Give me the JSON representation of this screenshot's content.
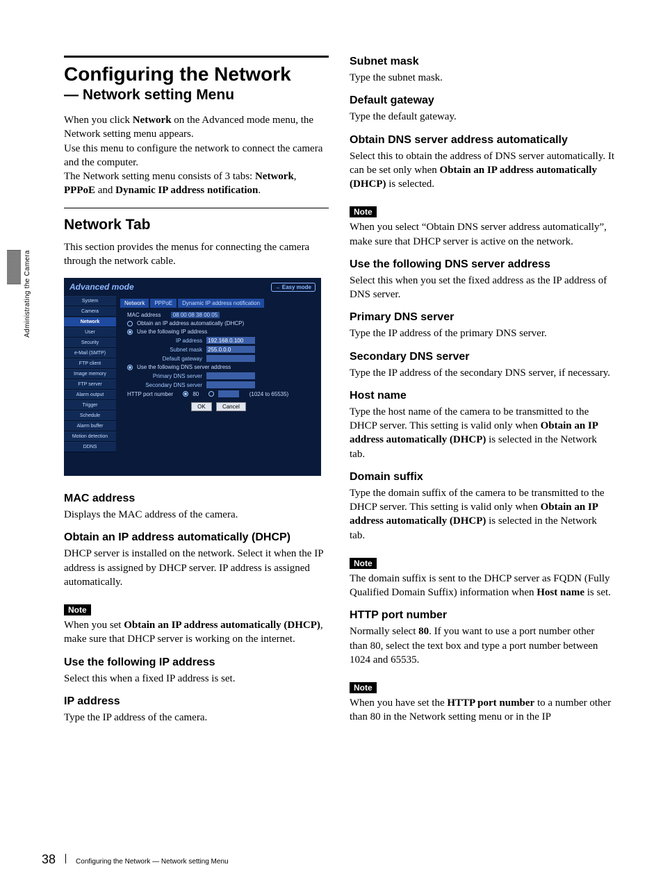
{
  "side_label": "Administrating the Camera",
  "page_number": "38",
  "footer_text": "Configuring the Network — Network setting Menu",
  "left": {
    "main_title": "Configuring the Network",
    "sub_title": "— Network setting Menu",
    "intro_1_pre": "When you click ",
    "intro_1_b1": "Network",
    "intro_1_post": " on the Advanced mode menu, the Network setting menu appears.",
    "intro_2": "Use this menu to configure the network to connect the camera and the computer.",
    "intro_3_pre": "The Network setting menu consists of 3 tabs: ",
    "intro_3_b1": "Network",
    "intro_3_mid": ", ",
    "intro_3_b2": "PPPoE",
    "intro_3_mid2": " and ",
    "intro_3_b3": "Dynamic IP address notification",
    "intro_3_end": ".",
    "h2_network_tab": "Network Tab",
    "nt_text": "This section provides the menus for connecting the camera through the network cable.",
    "mac_h": "MAC address",
    "mac_t": "Displays the MAC address of the camera.",
    "dhcp_h": "Obtain an IP address automatically (DHCP)",
    "dhcp_t": "DHCP server is installed on the network. Select it when the IP address is assigned by DHCP server. IP address is assigned automatically.",
    "note_label": "Note",
    "dhcp_note_pre": "When you set ",
    "dhcp_note_b": "Obtain an IP address automatically (DHCP)",
    "dhcp_note_post": ", make sure that DHCP server is working on the internet.",
    "useip_h": "Use the following IP address",
    "useip_t": "Select this when a fixed IP address is set.",
    "ipaddr_h": "IP address",
    "ipaddr_t": "Type the IP address of the camera."
  },
  "right": {
    "subnet_h": "Subnet mask",
    "subnet_t": "Type the subnet mask.",
    "gateway_h": "Default gateway",
    "gateway_t": "Type the default gateway.",
    "obtdns_h": "Obtain DNS server address automatically",
    "obtdns_t_pre": "Select this to obtain the address of DNS server automatically. It can be set only when ",
    "obtdns_t_b": "Obtain an IP address automatically (DHCP)",
    "obtdns_t_post": " is selected.",
    "note_label": "Note",
    "obtdns_note": "When you select “Obtain DNS server address automatically”, make sure that DHCP server is active on the network.",
    "usedns_h": "Use the following DNS server address",
    "usedns_t": "Select this when you set the fixed address as the IP address of DNS server.",
    "pdns_h": "Primary DNS server",
    "pdns_t": "Type the IP address of the primary DNS server.",
    "sdns_h": "Secondary DNS server",
    "sdns_t": "Type the IP address of the secondary DNS server, if necessary.",
    "host_h": "Host name",
    "host_t_pre": "Type the host name of the camera to be transmitted to the DHCP server. This setting is valid only when ",
    "host_t_b": "Obtain an IP address automatically (DHCP)",
    "host_t_post": " is selected in the Network tab.",
    "dom_h": "Domain suffix",
    "dom_t_pre": "Type the domain suffix of the camera to be transmitted to the DHCP server. This setting is valid only when ",
    "dom_t_b": "Obtain an IP address automatically (DHCP)",
    "dom_t_post": " is selected in the Network tab.",
    "dom_note_pre": "The domain suffix is sent to the DHCP server as FQDN (Fully Qualified Domain Suffix) information when ",
    "dom_note_b": "Host name",
    "dom_note_post": " is set.",
    "http_h": "HTTP port number",
    "http_t_pre": "Normally select ",
    "http_t_b": "80",
    "http_t_post": ".  If you want to use a port number other than 80, select the text box and type a port number between 1024 and 65535.",
    "http_note_pre": "When you have set the ",
    "http_note_b": "HTTP port number",
    "http_note_post": " to a number other than 80 in the Network setting menu or in the IP"
  },
  "screenshot": {
    "mode_title": "Advanced mode",
    "easy_mode_btn": "→ Easy mode",
    "sidebar": [
      "System",
      "Camera",
      "Network",
      "User",
      "Security",
      "e-Mail (SMTP)",
      "FTP client",
      "Image memory",
      "FTP server",
      "Alarm output",
      "Trigger",
      "Schedule",
      "Alarm buffer",
      "Motion detection",
      "DDNS"
    ],
    "active_side_index": 2,
    "tabs": [
      "Network",
      "PPPoE",
      "Dynamic IP address notification"
    ],
    "active_tab_index": 0,
    "mac_label": "MAC address",
    "mac_value": "08 00 08 38 00 05",
    "opt_dhcp": "Obtain an IP address automatically (DHCP)",
    "opt_static": "Use the following IP address",
    "row_ip_label": "IP address",
    "row_ip_value": "192.168.0.100",
    "row_mask_label": "Subnet mask",
    "row_mask_value": "255.0.0.0",
    "row_gw_label": "Default gateway",
    "row_gw_value": "",
    "opt_dns": "Use the following DNS server address",
    "row_pdns": "Primary DNS server",
    "row_sdns": "Secondary DNS server",
    "http_label": "HTTP port number",
    "http_opt1": "80",
    "http_range": "(1024 to 65535)",
    "ok": "OK",
    "cancel": "Cancel"
  }
}
